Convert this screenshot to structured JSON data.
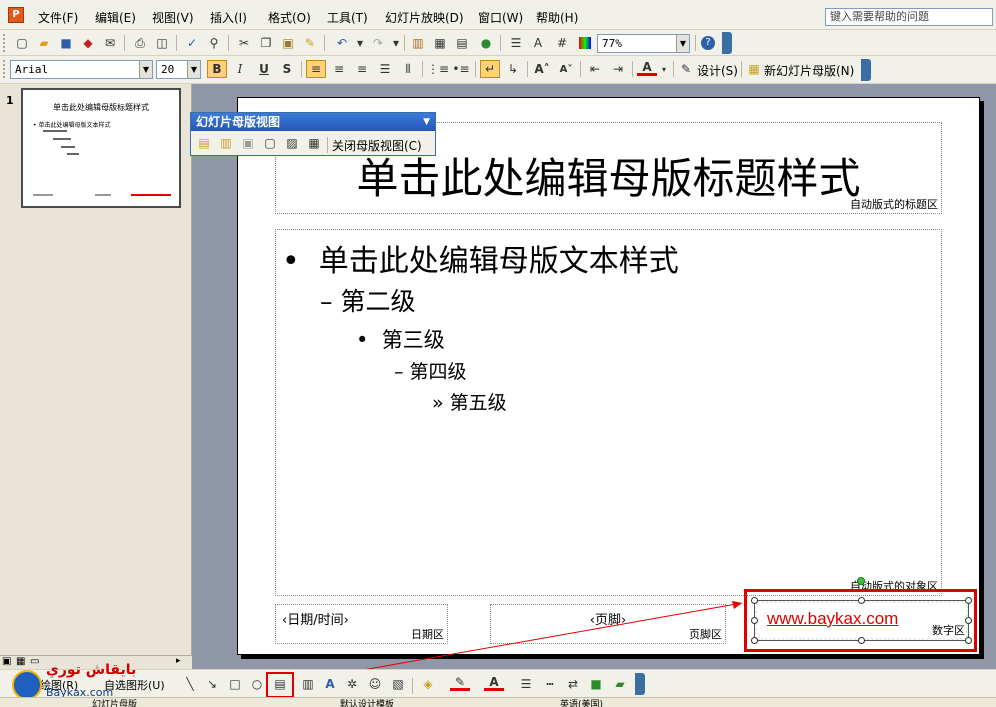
{
  "menu": {
    "items": [
      "文件(F)",
      "编辑(E)",
      "视图(V)",
      "插入(I)",
      "格式(O)",
      "工具(T)",
      "幻灯片放映(D)",
      "窗口(W)",
      "帮助(H)"
    ],
    "help_placeholder": "键入需要帮助的问题"
  },
  "standard_toolbar": {
    "zoom": "77%"
  },
  "format_toolbar": {
    "font": "Arial",
    "size": "20",
    "bold": "B",
    "italic": "I",
    "underline": "U",
    "shadow": "S",
    "design_label": "设计(S)",
    "new_master_label": "新幻灯片母版(N)"
  },
  "master_toolbar": {
    "title": "幻灯片母版视图",
    "close_label": "关闭母版视图(C)"
  },
  "slide": {
    "title": "单击此处编辑母版标题样式",
    "title_area_label": "自动版式的标题区",
    "body": {
      "level1": "单击此处编辑母版文本样式",
      "level2": "第二级",
      "level3": "第三级",
      "level4": "第四级",
      "level5": "第五级"
    },
    "object_area_label": "自动版式的对象区",
    "date": {
      "text": "‹日期/时间›",
      "label": "日期区"
    },
    "footer": {
      "text": "‹页脚›",
      "label": "页脚区"
    },
    "number": {
      "label": "数字区",
      "watermark_text": "www.baykax.com"
    }
  },
  "thumbnail": {
    "number": "1",
    "title": "单击此处编辑母版标题样式",
    "body": "单击此处编辑母版文本样式"
  },
  "drawing_toolbar": {
    "draw_label": "绘图(R)",
    "autoshape_label": "自选图形(U)"
  },
  "status": {
    "view": "幻灯片母版",
    "template": "默认设计模板",
    "language": "英语(美国)"
  },
  "watermark": {
    "text": "بايقاش توري",
    "url": "Baykax.com"
  },
  "colors": {
    "highlight_red": "#E00000",
    "title_bar_blue": "#2456B9",
    "canvas_gray": "#8F97A8"
  }
}
